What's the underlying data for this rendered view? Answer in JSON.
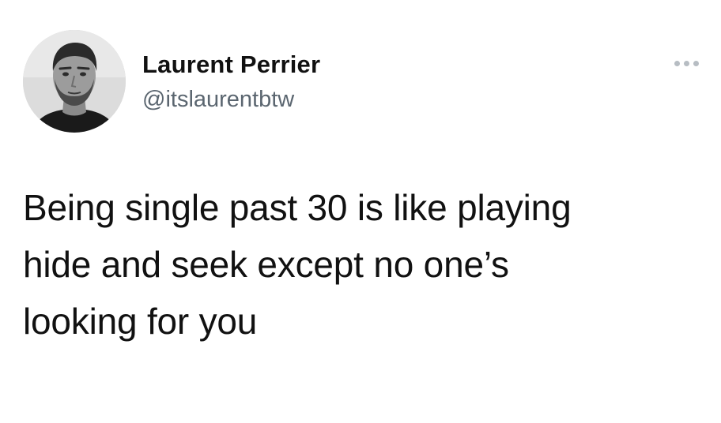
{
  "author": {
    "display_name": "Laurent Perrier",
    "handle": "@itslaurentbtw",
    "avatar": "profile-photo-avatar"
  },
  "tweet": {
    "lines": [
      "Being single past 30 is like playing",
      "hide and seek except no one’s",
      "looking for you"
    ]
  },
  "actions": {
    "more_icon": "more-horizontal-icon"
  },
  "colors": {
    "background": "#ffffff",
    "text": "#111111",
    "handle": "#5b6670",
    "more_dots": "#b7bdc3"
  }
}
